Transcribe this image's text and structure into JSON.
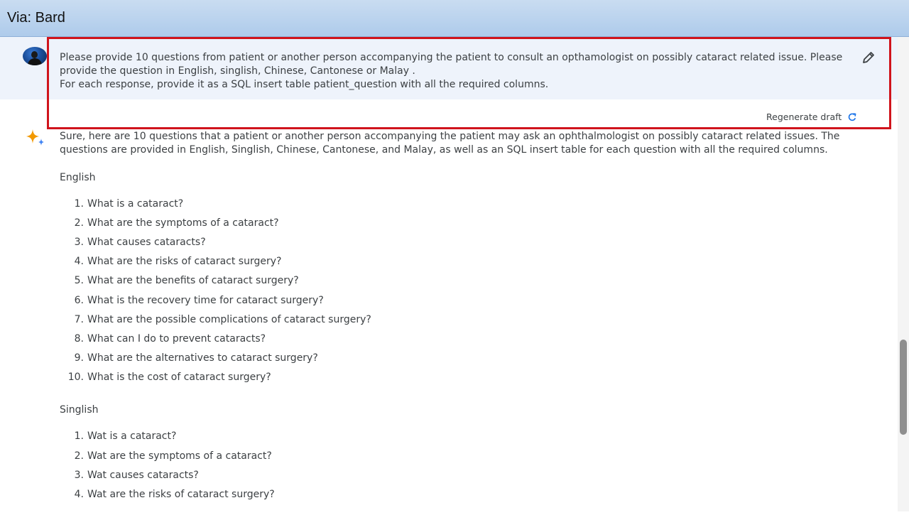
{
  "header": {
    "title": "Via: Bard"
  },
  "prompt": {
    "lines": [
      "Please provide 10 questions from patient or another person accompanying the patient to consult an opthamologist on possibly cataract related issue. Please provide the question in English, singlish, Chinese, Cantonese or Malay .",
      "For each response, provide it as a SQL insert table patient_question with all the required columns."
    ]
  },
  "response": {
    "regenerate_label": "Regenerate draft",
    "intro": "Sure, here are 10 questions that a patient or another person accompanying the patient may ask an ophthalmologist on possibly cataract related issues. The questions are provided in English, Singlish, Chinese, Cantonese, and Malay, as well as an SQL insert table for each question with all the required columns.",
    "sections": [
      {
        "heading": "English",
        "items": [
          "What is a cataract?",
          "What are the symptoms of a cataract?",
          "What causes cataracts?",
          "What are the risks of cataract surgery?",
          "What are the benefits of cataract surgery?",
          "What is the recovery time for cataract surgery?",
          "What are the possible complications of cataract surgery?",
          "What can I do to prevent cataracts?",
          "What are the alternatives to cataract surgery?",
          "What is the cost of cataract surgery?"
        ]
      },
      {
        "heading": "Singlish",
        "items": [
          "Wat is a cataract?",
          "Wat are the symptoms of a cataract?",
          "Wat causes cataracts?",
          "Wat are the risks of cataract surgery?"
        ]
      }
    ]
  },
  "colors": {
    "highlight": "#d0141c",
    "prompt_bg": "#eef3fb",
    "header_bg": "#aecbeb",
    "sparkle_blue": "#4285f4",
    "sparkle_orange": "#f29900"
  },
  "icons": {
    "edit": "pencil-icon",
    "regenerate": "refresh-icon",
    "assistant": "sparkle-icon",
    "user": "avatar"
  }
}
